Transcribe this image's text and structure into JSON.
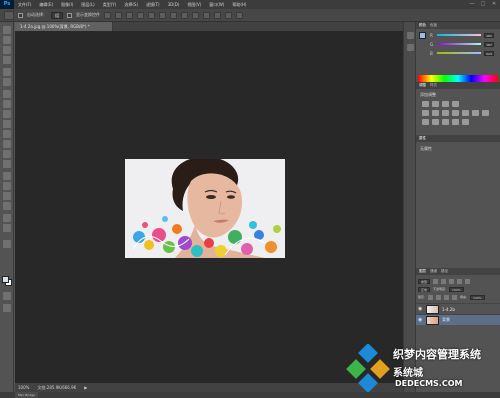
{
  "app": {
    "logo": "Ps"
  },
  "menu": [
    "文件(F)",
    "编辑(E)",
    "图像(I)",
    "图层(L)",
    "类型(Y)",
    "选择(S)",
    "滤镜(T)",
    "3D(D)",
    "视图(V)",
    "窗口(W)",
    "帮助(H)"
  ],
  "window_controls": [
    "—",
    "□",
    "✕"
  ],
  "options": {
    "auto_select_label": "自动选择：",
    "auto_select_value": "组",
    "show_transform_label": "显示变换控件"
  },
  "document": {
    "tab_title": "1-4 2a.jpg @ 100%(背景, RGB/8*) *",
    "zoom": "100%",
    "doc_size": "文档:285.9K/666.9K",
    "bottom_tab": "Mini Bridge"
  },
  "color_panel": {
    "tabs": [
      "颜色",
      "色板"
    ],
    "sliders": [
      {
        "letter": "R",
        "value": "161",
        "color": "#e04040"
      },
      {
        "letter": "G",
        "value": "187",
        "color": "#40c040"
      },
      {
        "letter": "B",
        "value": "224",
        "color": "#4070e0"
      }
    ]
  },
  "adjust_panel": {
    "tabs": [
      "调整",
      "样式"
    ],
    "label": "添加调整"
  },
  "props_panel": {
    "tabs": [
      "属性"
    ],
    "label": "无属性"
  },
  "layers_panel": {
    "tabs": [
      "图层",
      "通道",
      "路径"
    ],
    "kind": "类型",
    "blend": "正常",
    "opacity_label": "不透明度:",
    "opacity": "100%",
    "lock_label": "锁定:",
    "fill_label": "填充:",
    "fill": "100%",
    "layers": [
      {
        "name": "1-4.2b"
      },
      {
        "name": "背景"
      }
    ]
  },
  "watermark": {
    "line1": "织梦内容管理系统",
    "line2": "系统城",
    "url": "DEDECMS.COM"
  },
  "colors": {
    "accent": "#31a8ff",
    "canvas": "#282828",
    "panel": "#535353"
  }
}
